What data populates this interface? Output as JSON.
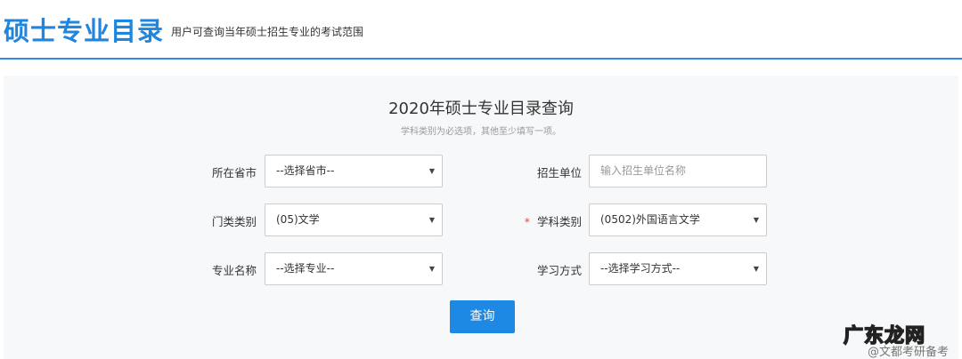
{
  "header": {
    "title": "硕士专业目录",
    "subtitle": "用户可查询当年硕士招生专业的考试范围"
  },
  "form": {
    "title": "2020年硕士专业目录查询",
    "hint": "学科类别为必选项，其他至少填写一项。",
    "fields": [
      {
        "label": "所在省市",
        "value": "--选择省市--",
        "type": "select"
      },
      {
        "label": "招生单位",
        "placeholder": "输入招生单位名称",
        "type": "input"
      },
      {
        "label": "门类类别",
        "value": "(05)文学",
        "type": "select"
      },
      {
        "label": "学科类别",
        "value": "(0502)外国语言文学",
        "type": "select",
        "required_mark": "*"
      },
      {
        "label": "专业名称",
        "value": "--选择专业--",
        "type": "select"
      },
      {
        "label": "学习方式",
        "value": "--选择学习方式--",
        "type": "select"
      }
    ],
    "submit": "查询"
  },
  "watermark": {
    "logo": "广东龙网",
    "credit": "@文都考研备考"
  }
}
